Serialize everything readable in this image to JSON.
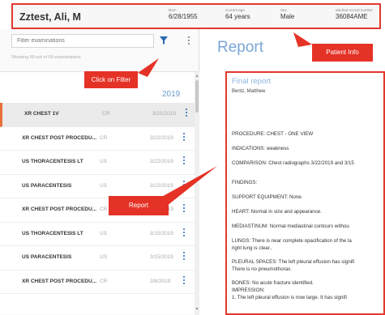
{
  "patient": {
    "name": "Zztest, Ali, M",
    "born_label": "Born",
    "born_value": "6/28/1955",
    "age_label": "Current age",
    "age_value": "64 years",
    "sex_label": "Sex",
    "sex_value": "Male",
    "mrn_label": "Medical record number",
    "mrn_value": "36084AME"
  },
  "sidebar": {
    "filter_placeholder": "Filter examinations",
    "showing_text": "Showing 69 out of 69 examinations",
    "year": "2019",
    "items": [
      {
        "name": "XR CHEST 1V",
        "modality": "CR",
        "date": "3/25/2019"
      },
      {
        "name": "XR CHEST POST PROCEDU...",
        "modality": "CR",
        "date": "3/22/2019"
      },
      {
        "name": "US THORACENTESIS LT",
        "modality": "US",
        "date": "3/22/2019"
      },
      {
        "name": "US PARACENTESIS",
        "modality": "US",
        "date": "3/22/2019"
      },
      {
        "name": "XR CHEST POST PROCEDU...",
        "modality": "CR",
        "date": "3/19/2019"
      },
      {
        "name": "US THORACENTESIS LT",
        "modality": "US",
        "date": "3/15/2019"
      },
      {
        "name": "US PARACENTESIS",
        "modality": "US",
        "date": "3/15/2019"
      },
      {
        "name": "XR CHEST POST PROCEDU...",
        "modality": "CR",
        "date": "3/8/2019"
      }
    ]
  },
  "report": {
    "title": "Report",
    "final_report_label": "Final report",
    "author": "Bentz, Matthew",
    "lines": [
      "PROCEDURE: CHEST - ONE VIEW",
      "INDICATIONS: weakness",
      "COMPARISON: Chest radiographs 3/22/2019 and 3/15",
      "FINDINGS:",
      "SUPPORT EQUIPMENT: None.",
      "HEART: Normal in size and appearance.",
      "MEDIASTINUM: Normal mediastinal contours withou",
      "LUNGS: There is near complete opacification of the la",
      "right lung is clear..",
      "PLEURAL SPACES: The left pleural effusion has signifi",
      "There is no pneumothorax.",
      "BONES: No acute fracture identified.",
      "IMPRESSION:",
      "1. The left pleural effusion is now large. It has signifi"
    ]
  },
  "annotations": {
    "patient_info": "Patient Info",
    "click_on_filter": "Click on Filter",
    "report": "Report"
  },
  "colors": {
    "annotation_red": "#e53226",
    "accent_blue": "#7aa7d7",
    "selected_marker": "#e8703a"
  }
}
